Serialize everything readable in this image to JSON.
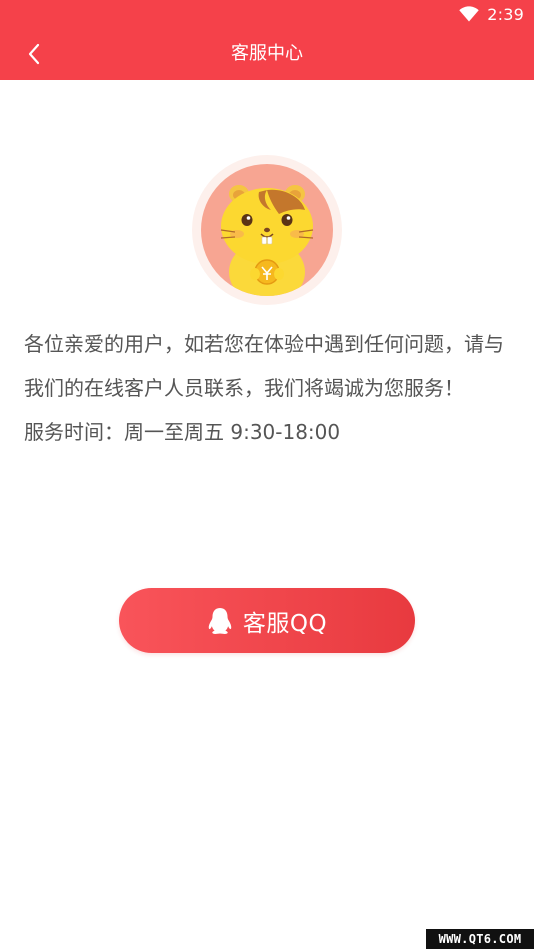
{
  "status_bar": {
    "time": "2:39",
    "icons": [
      "wifi-icon"
    ]
  },
  "title_bar": {
    "title": "客服中心",
    "back_icon": "chevron-left-icon"
  },
  "avatar": {
    "icon": "hamster-mascot-icon"
  },
  "content": {
    "description": "各位亲爱的用户，如若您在体验中遇到任何问题，请与我们的在线客户人员联系，我们将竭诚为您服务！",
    "service_time": "服务时间：周一至周五 9:30-18:00"
  },
  "qq_button": {
    "label": "客服QQ",
    "icon": "qq-penguin-icon"
  },
  "watermark": {
    "text": "WWW.QT6.COM"
  },
  "colors": {
    "header": "#f5414a",
    "button_start": "#f9545a",
    "button_end": "#e83a3f",
    "text": "#555555",
    "background": "#ffffff"
  }
}
